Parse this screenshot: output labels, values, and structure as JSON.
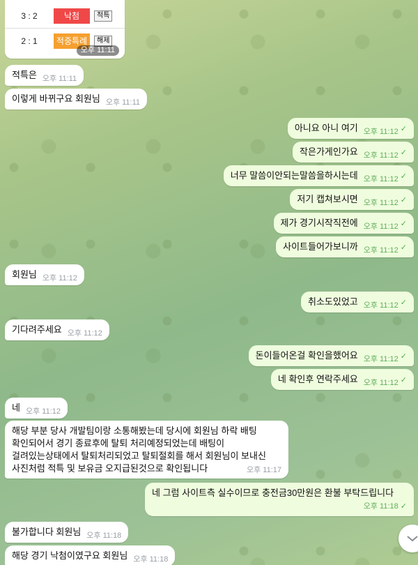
{
  "image_bubble": {
    "rows": [
      {
        "score": "3 : 2",
        "tag": "낙첨",
        "tag_color": "#f04848",
        "button": "적특"
      },
      {
        "score": "2 : 1",
        "tag": "적중특례",
        "tag_color": "#f5a030",
        "button": "해제"
      }
    ],
    "time": "오후 11:11"
  },
  "messages": [
    {
      "text": "적특은",
      "time": "오후 11:11"
    },
    {
      "text": "이렇게 바뀌구요 회원님",
      "time": "오후 11:11"
    },
    {
      "text": "아니요 아니 여기",
      "time": "오후 11:12",
      "check": "✓"
    },
    {
      "text": "작은가게인가요",
      "time": "오후 11:12",
      "check": "✓"
    },
    {
      "text": "너무 말씀이안되는말씀을하시는데",
      "time": "오후 11:12",
      "check": "✓"
    },
    {
      "text": "저기 캡쳐보시면",
      "time": "오후 11:12",
      "check": "✓"
    },
    {
      "text": "제가 경기시작직전에",
      "time": "오후 11:12",
      "check": "✓"
    },
    {
      "text": "사이트들어가보니까",
      "time": "오후 11:12",
      "check": "✓"
    },
    {
      "text": "회원님",
      "time": "오후 11:12"
    },
    {
      "text": "취소도있었고",
      "time": "오후 11:12",
      "check": "✓"
    },
    {
      "text": "기다려주세요",
      "time": "오후 11:12"
    },
    {
      "text": "돈이들어온걸 확인을했어요",
      "time": "오후 11:12",
      "check": "✓"
    },
    {
      "text": "네 확인후 연락주세요",
      "time": "오후 11:12",
      "check": "✓"
    },
    {
      "text": "네",
      "time": "오후 11:12"
    },
    {
      "lines": [
        "해당 부분 당사 개발팀이랑 소통해봤는데 당시에 회원님 하락 배팅",
        "확인되어서 경기 종료후에 탈퇴 처리예정되었는데 배팅이",
        "걸려있는상태에서 탈퇴처리되었고 탈퇴절회를 해서 회원님이 보내신",
        "사진처럼 적특 및 보유금 오지급된것으로 확인됩니다"
      ],
      "time": "오후 11:17"
    },
    {
      "text": "네 그럼 사이트측 실수이므로 충전금30만원은 환불 부탁드립니다",
      "time": "오후 11:18",
      "check": "✓"
    },
    {
      "text": "불가합니다 회원님",
      "time": "오후 11:18"
    },
    {
      "text": "해당 경기 낙첨이였구요 회원님",
      "time": "오후 11:18"
    }
  ]
}
